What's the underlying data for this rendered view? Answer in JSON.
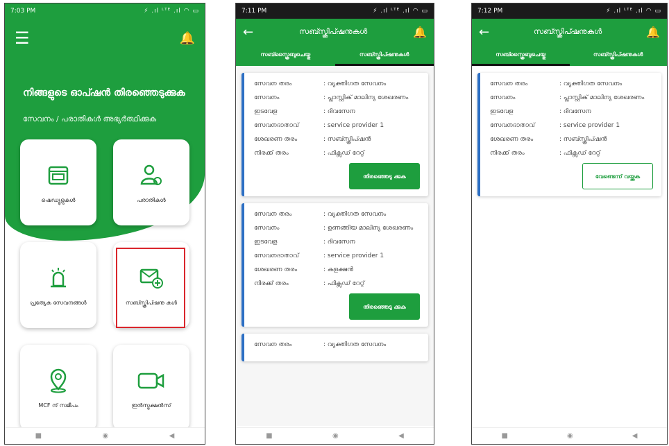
{
  "colors": {
    "brand_green": "#1e9e3e",
    "selection_red": "#d9262c",
    "card_accent": "#2c6fc4"
  },
  "screen1": {
    "status_time": "7:03 PM",
    "status_right": "⚡ .ıl ᴸᵀᴱ .ıl ◠ ▭",
    "title": "നിങ്ങളുടെ ഓപ്ഷൻ തിരഞ്ഞെടുക്കുക",
    "subtitle": "സേവനം / പരാതികൾ അഭ്യർത്ഥിക്കുക",
    "tiles": [
      {
        "label": "ഷെഡ്യൂളുകൾ",
        "icon": "schedule-icon"
      },
      {
        "label": "പരാതികൾ",
        "icon": "complaint-user-icon"
      },
      {
        "label": "പ്രത്യേക സേവനങ്ങൾ",
        "icon": "special-service-siren-icon"
      },
      {
        "label": "സബ്സ്ക്രിപ്ഷനു കൾ",
        "icon": "subscription-mail-add-icon"
      },
      {
        "label": "MCF ന് സമീപം",
        "icon": "location-pin-icon"
      },
      {
        "label": "ഇൻസ്ട്രക്ഷൻസ്",
        "icon": "video-camera-icon"
      }
    ]
  },
  "screen2": {
    "status_time": "7:11 PM",
    "status_right": "⚡ .ıl ᴸᵀᴱ .ıl ◠ ▭",
    "title": "സബ്സ്ക്രിപ്ഷനുകൾ",
    "tabs": [
      "സബ്സ്ക്രൈബുചെയ്തു",
      "സബ്സ്ക്രിപ്ഷനുകൾ"
    ],
    "active_tab": 1,
    "labels": [
      "സേവന തരം",
      "സേവനം",
      "ഇടവേള",
      "സേവനദാതാവ്",
      "ശേഖരണ തരം",
      "നിരക്ക് തരം"
    ],
    "cards": [
      {
        "values": [
          ": വ്യക്തിഗത സേവനം",
          ": പ്ലാസ്റ്റിക് മാലിന്യ ശേഖരണം",
          ": ദിവസേന",
          ": service provider 1",
          ": സബ്സ്ക്രിപ്ഷൻ",
          ": ഫിക്സഡ് റേറ്റ്"
        ],
        "button": "തിരഞ്ഞെടു ക്കുക"
      },
      {
        "values": [
          ": വ്യക്തിഗത സേവനം",
          ": ഉണങ്ങിയ മാലിന്യ ശേഖരണം",
          ": ദിവസേന",
          ": service provider 1",
          ": കളക്ഷൻ",
          ": ഫിക്സഡ് റേറ്റ്"
        ],
        "button": "തിരഞ്ഞെടു ക്കുക"
      },
      {
        "values": [
          ": വ്യക്തിഗത സേവനം"
        ]
      }
    ]
  },
  "screen3": {
    "status_time": "7:12 PM",
    "status_right": "⚡ .ıl ᴸᵀᴱ .ıl ◠ ▭",
    "title": "സബ്സ്ക്രിപ്ഷനുകൾ",
    "tabs": [
      "സബ്സ്ക്രൈബുചെയ്തു",
      "സബ്സ്ക്രിപ്ഷനുകൾ"
    ],
    "active_tab": 0,
    "labels": [
      "സേവന തരം",
      "സേവനം",
      "ഇടവേള",
      "സേവനദാതാവ്",
      "ശേഖരണ തരം",
      "നിരക്ക് തരം"
    ],
    "card": {
      "values": [
        ": വ്യക്തിഗത സേവനം",
        ": പ്ലാസ്റ്റിക് മാലിന്യ ശേഖരണം",
        ": ദിവസേന",
        ": service provider 1",
        ": സബ്സ്ക്രിപ്ഷൻ",
        ": ഫിക്സഡ് റേറ്റ്"
      ],
      "button": "വേണ്ടെന്ന് വയ്ക്കുക"
    }
  }
}
